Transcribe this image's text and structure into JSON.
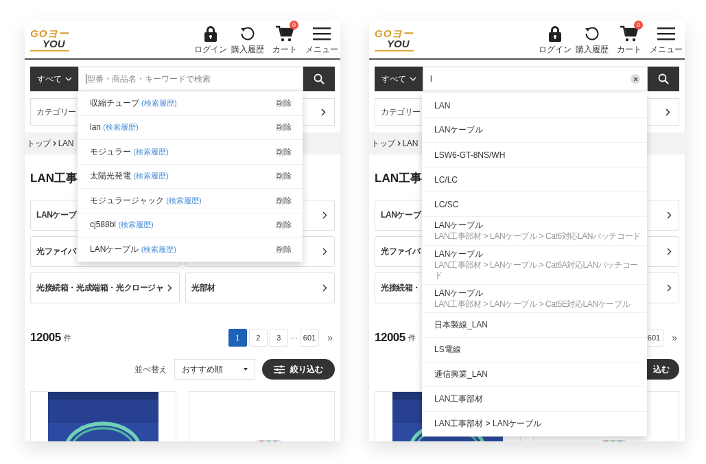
{
  "screens": [
    {
      "logo": {
        "top": "GOヨー",
        "bottom": "YOU"
      },
      "nav": [
        {
          "kind": "lock",
          "label": "ログイン"
        },
        {
          "kind": "history",
          "label": "購入履歴"
        },
        {
          "kind": "cart",
          "label": "カート",
          "badge": "0"
        },
        {
          "kind": "menu",
          "label": "メニュー"
        }
      ],
      "search": {
        "scope": "すべて",
        "placeholder": "型番・商品名・キーワードで検索"
      },
      "category_select": {
        "label": "カテゴリー"
      },
      "breadcrumb": [
        "トップ",
        "LAN"
      ],
      "heading": "LAN工事",
      "category_cards": [
        {
          "kind": "cut",
          "label": "LANケーブ"
        },
        {
          "kind": "blank"
        },
        {
          "kind": "cut",
          "label": "光ファイバ"
        },
        {
          "kind": "blank"
        },
        {
          "kind": "labeled",
          "label": "光接続箱・光成端箱・光クロージャ"
        },
        {
          "kind": "labeled",
          "label": "光部材"
        }
      ],
      "result_count": "12005",
      "count_unit": "件",
      "pages": [
        {
          "kind": "page",
          "label": "1",
          "selected": true
        },
        {
          "kind": "page",
          "label": "2",
          "selected": false
        },
        {
          "kind": "page",
          "label": "3",
          "selected": false
        },
        {
          "kind": "gap",
          "label": "···"
        },
        {
          "kind": "page",
          "label": "601",
          "selected": false
        },
        {
          "kind": "next",
          "label": "»"
        }
      ],
      "sort": {
        "label": "並べ替え",
        "value": "おすすめ順"
      },
      "filter_button": {
        "label": "絞り込む",
        "icon": true
      },
      "products": [
        {
          "kind": "picture"
        },
        {
          "kind": "picture"
        }
      ],
      "dropdown": {
        "kind": "history",
        "items": [
          {
            "text": "収縮チューブ",
            "tag": "(検索履歴)",
            "action": "削除"
          },
          {
            "text": "lan",
            "tag": "(検索履歴)",
            "action": "削除"
          },
          {
            "text": "モジュラー",
            "tag": "(検索履歴)",
            "action": "削除"
          },
          {
            "text": "太陽光発電",
            "tag": "(検索履歴)",
            "action": "削除"
          },
          {
            "text": "モジュラージャック",
            "tag": "(検索履歴)",
            "action": "削除"
          },
          {
            "text": "cj588bl",
            "tag": "(検索履歴)",
            "action": "削除"
          },
          {
            "text": "LANケーブル",
            "tag": "(検索履歴)",
            "action": "削除"
          }
        ]
      }
    },
    {
      "logo": {
        "top": "GOヨー",
        "bottom": "YOU"
      },
      "nav": [
        {
          "kind": "lock",
          "label": "ログイン"
        },
        {
          "kind": "history",
          "label": "購入履歴"
        },
        {
          "kind": "cart",
          "label": "カート",
          "badge": "0"
        },
        {
          "kind": "menu",
          "label": "メニュー"
        }
      ],
      "search": {
        "scope": "すべて",
        "value": "l",
        "clearable": true
      },
      "category_select": {
        "label": "カテゴリー"
      },
      "breadcrumb": [
        "トップ",
        "LAN"
      ],
      "heading": "LAN工事",
      "category_cards": [
        {
          "kind": "cut",
          "label": "LANケーブ"
        },
        {
          "kind": "blank"
        },
        {
          "kind": "cut",
          "label": "光ファイバ"
        },
        {
          "kind": "blank"
        },
        {
          "kind": "cut",
          "label": "光接続箱・"
        },
        {
          "kind": "blank"
        }
      ],
      "result_count": "12005",
      "count_unit": "件",
      "pages": [
        {
          "kind": "page",
          "label": "601",
          "selected": false
        },
        {
          "kind": "next",
          "label": "»"
        }
      ],
      "filter_button": {
        "label": "込む",
        "icon": false
      },
      "products": [
        {
          "kind": "picture"
        },
        {
          "kind": "picture"
        }
      ],
      "dropdown": {
        "kind": "suggest",
        "items": [
          {
            "text": "LAN"
          },
          {
            "text": "LANケーブル"
          },
          {
            "text": "LSW6-GT-8NS/WH"
          },
          {
            "text": "LC/LC"
          },
          {
            "text": "LC/SC"
          },
          {
            "text": "LANケーブル",
            "path": "LAN工事部材 > LANケーブル > Cat6対応LANパッチコード"
          },
          {
            "text": "LANケーブル",
            "path": "LAN工事部材 > LANケーブル > Cat6A対応LANパッチコード"
          },
          {
            "text": "LANケーブル",
            "path": "LAN工事部材 > LANケーブル > Cat5E対応LANケーブル"
          },
          {
            "text": "日本製線_LAN"
          },
          {
            "text": "LS電線"
          },
          {
            "text": "通信興業_LAN"
          },
          {
            "text": "LAN工事部材"
          },
          {
            "text": "LAN工事部材 > LANケーブル"
          }
        ]
      }
    }
  ]
}
